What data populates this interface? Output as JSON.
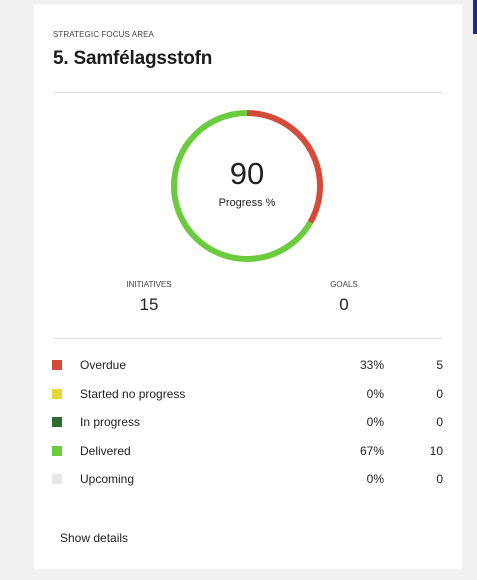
{
  "card": {
    "eyebrow": "STRATEGIC FOCUS AREA",
    "title": "5. Samfélagsstofn"
  },
  "progress": {
    "value": "90",
    "label": "Progress %",
    "ring_segments": [
      {
        "name": "Overdue",
        "fraction": 0.333,
        "color": "#d44b3a"
      },
      {
        "name": "Delivered",
        "fraction": 0.667,
        "color": "#6acb3c"
      }
    ]
  },
  "stats": {
    "initiatives_label": "INITIATIVES",
    "initiatives_value": "15",
    "goals_label": "GOALS",
    "goals_value": "0"
  },
  "legend": [
    {
      "label": "Overdue",
      "pct": "33%",
      "count": "5",
      "color": "#d44b3a"
    },
    {
      "label": "Started no progress",
      "pct": "0%",
      "count": "0",
      "color": "#e6d53c"
    },
    {
      "label": "In progress",
      "pct": "0%",
      "count": "0",
      "color": "#2e6b2e"
    },
    {
      "label": "Delivered",
      "pct": "67%",
      "count": "10",
      "color": "#6acb3c"
    },
    {
      "label": "Upcoming",
      "pct": "0%",
      "count": "0",
      "color": "#e6e6e6"
    }
  ],
  "footer": {
    "show_details_label": "Show details"
  }
}
